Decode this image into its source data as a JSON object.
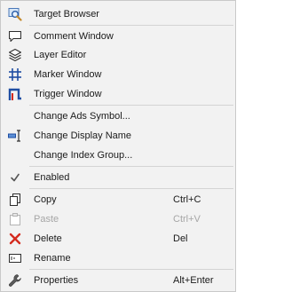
{
  "menu": {
    "items": [
      {
        "label": "Target Browser",
        "icon": "magnifier-screen-icon"
      },
      {
        "label": "Comment Window",
        "icon": "speech-bubble-icon"
      },
      {
        "label": "Layer Editor",
        "icon": "layers-icon"
      },
      {
        "label": "Marker Window",
        "icon": "marker-grid-icon"
      },
      {
        "label": "Trigger Window",
        "icon": "trigger-pulse-icon"
      },
      {
        "label": "Change Ads Symbol..."
      },
      {
        "label": "Change Display Name",
        "icon": "text-cursor-icon"
      },
      {
        "label": "Change Index Group..."
      },
      {
        "label": "Enabled",
        "checked": true,
        "icon": "checkmark-icon"
      },
      {
        "label": "Copy",
        "shortcut": "Ctrl+C",
        "icon": "copy-icon"
      },
      {
        "label": "Paste",
        "shortcut": "Ctrl+V",
        "disabled": true,
        "icon": "paste-icon"
      },
      {
        "label": "Delete",
        "shortcut": "Del",
        "icon": "red-x-icon"
      },
      {
        "label": "Rename",
        "icon": "rename-icon"
      },
      {
        "label": "Properties",
        "shortcut": "Alt+Enter",
        "icon": "wrench-icon"
      }
    ]
  },
  "colors": {
    "background": "#f2f2f2",
    "text": "#1a1a1a",
    "disabled_text": "#a6a6a6",
    "delete_red": "#d42a1e",
    "icon_blue": "#1f4ea3"
  }
}
